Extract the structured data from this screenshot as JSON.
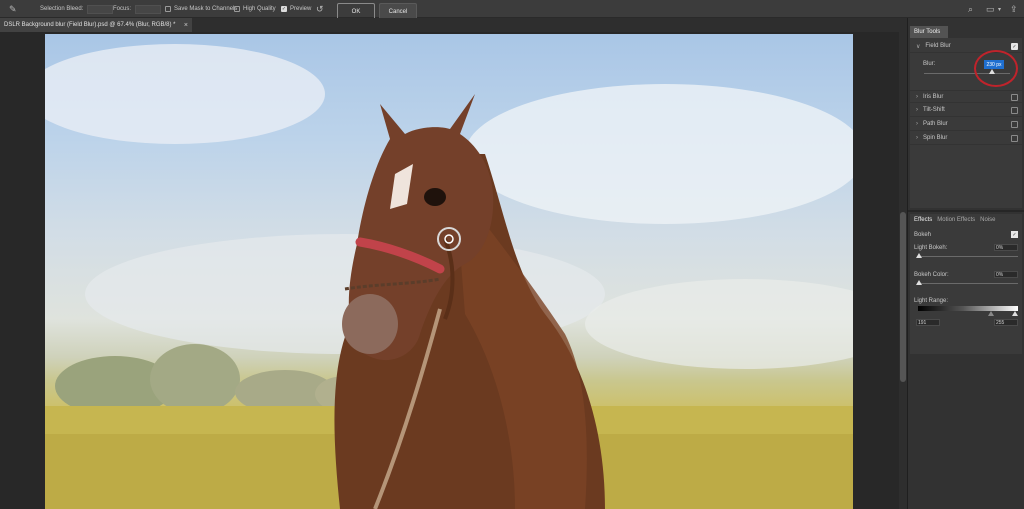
{
  "options_bar": {
    "selection_bleed_label": "Selection Bleed:",
    "focus_label": "Focus:",
    "save_mask_label": "Save Mask to Channels",
    "high_quality_label": "High Quality",
    "preview_label": "Preview",
    "preview_checked": true,
    "ok_label": "OK",
    "cancel_label": "Cancel"
  },
  "document": {
    "tab_title": "DSLR Background blur (Field Blur).psd @ 67.4% (Blur, RGB/8) *",
    "close_symbol": "×"
  },
  "blur_tools": {
    "panel_tab": "Blur Tools",
    "field_blur": {
      "label": "Field Blur",
      "checked": true,
      "blur_label": "Blur:",
      "blur_value": "230 px"
    },
    "items": [
      {
        "label": "Iris Blur",
        "checked": false
      },
      {
        "label": "Tilt-Shift",
        "checked": false
      },
      {
        "label": "Path Blur",
        "checked": false
      },
      {
        "label": "Spin Blur",
        "checked": false
      }
    ]
  },
  "effects": {
    "tabs": [
      "Effects",
      "Motion Effects",
      "Noise"
    ],
    "bokeh_label": "Bokeh",
    "bokeh_checked": true,
    "light_bokeh_label": "Light Bokeh:",
    "light_bokeh_value": "0%",
    "bokeh_color_label": "Bokeh Color:",
    "bokeh_color_value": "0%",
    "light_range_label": "Light Range:",
    "light_range_low": "191",
    "light_range_high": "255"
  },
  "colors": {
    "accent": "#1f6fd0",
    "annotation": "#c0232b"
  }
}
